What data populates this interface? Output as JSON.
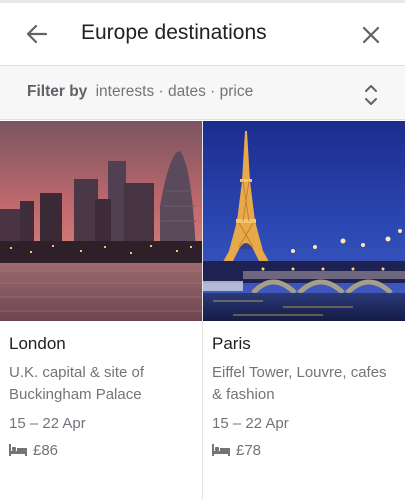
{
  "header": {
    "title": "Europe destinations",
    "back_icon": "arrow-left-icon",
    "close_icon": "close-icon"
  },
  "filter": {
    "label": "Filter by",
    "values": "interests · dates · price",
    "expand_icon": "unfold-more-icon"
  },
  "destinations": [
    {
      "name": "London",
      "description": "U.K. capital & site of Buckingham Palace",
      "dates": "15 – 22 Apr",
      "price": "£86",
      "price_icon": "bed-icon"
    },
    {
      "name": "Paris",
      "description": "Eiffel Tower, Louvre, cafes & fashion",
      "dates": "15 – 22 Apr",
      "price": "£78",
      "price_icon": "bed-icon"
    }
  ],
  "colors": {
    "text_primary": "#202124",
    "text_secondary": "#70757a",
    "filter_bg": "#f7f7f7"
  }
}
